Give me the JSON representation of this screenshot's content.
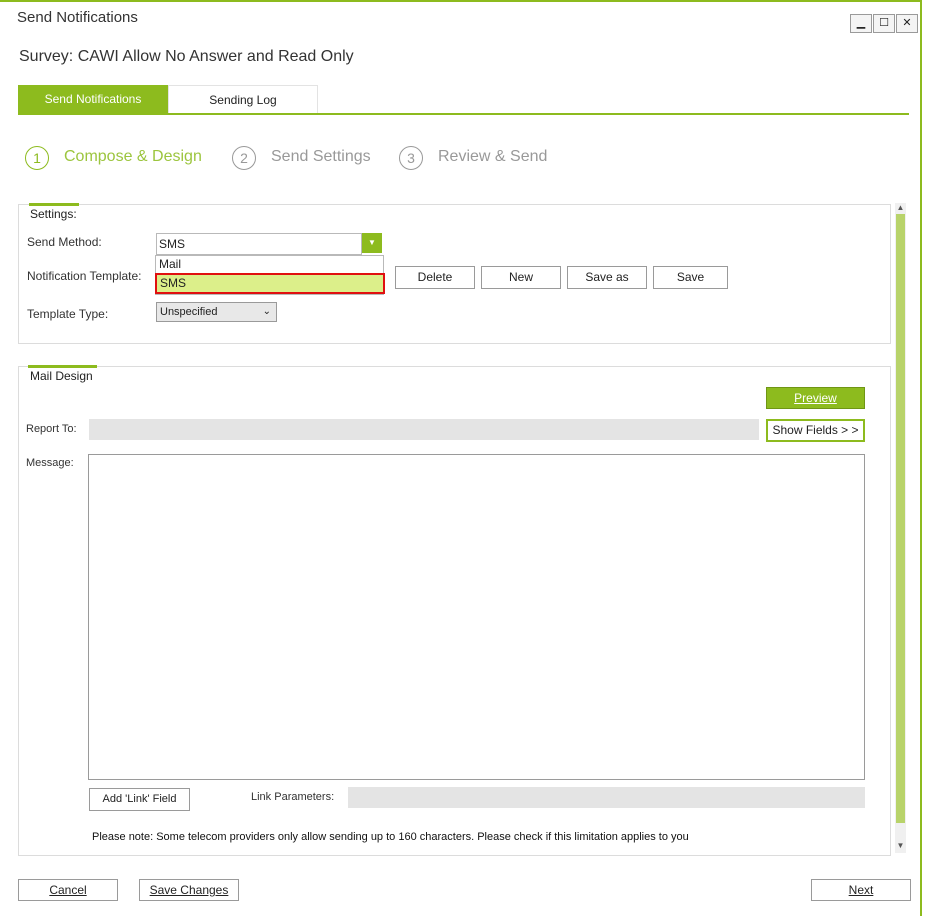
{
  "window": {
    "title": "Send Notifications",
    "minimize_glyph": "▁",
    "maximize_glyph": "☐",
    "close_glyph": "✕"
  },
  "survey_title": "Survey: CAWI Allow No Answer and Read Only",
  "tabs": [
    {
      "label": "Send Notifications",
      "active": true
    },
    {
      "label": "Sending Log",
      "active": false
    }
  ],
  "steps": [
    {
      "number": "1",
      "label": "Compose & Design",
      "active": true
    },
    {
      "number": "2",
      "label": "Send Settings",
      "active": false
    },
    {
      "number": "3",
      "label": "Review & Send",
      "active": false
    }
  ],
  "settings": {
    "title": "Settings:",
    "send_method_label": "Send Method:",
    "send_method_value": "SMS",
    "send_method_options": [
      "Mail",
      "SMS"
    ],
    "notification_template_label": "Notification Template:",
    "template_buttons": {
      "delete": "Delete",
      "new": "New",
      "save_as": "Save as",
      "save": "Save"
    },
    "template_type_label": "Template Type:",
    "template_type_value": "Unspecified"
  },
  "mail_design": {
    "title": "Mail Design",
    "preview_button": "Preview",
    "show_fields_button": "Show Fields > >",
    "report_to_label": "Report To:",
    "report_to_value": "",
    "message_label": "Message:",
    "message_value": "",
    "add_link_button": "Add 'Link' Field",
    "link_parameters_label": "Link Parameters:",
    "link_parameters_value": "",
    "note": "Please note: Some telecom providers only allow sending up to 160 characters. Please check if this limitation applies to you"
  },
  "footer": {
    "cancel": "Cancel",
    "save_changes": "Save Changes",
    "next": "Next"
  },
  "colors": {
    "accent": "#8dbb1e",
    "selected_option_bg": "#dcef8a",
    "highlight_border": "#e01010"
  }
}
